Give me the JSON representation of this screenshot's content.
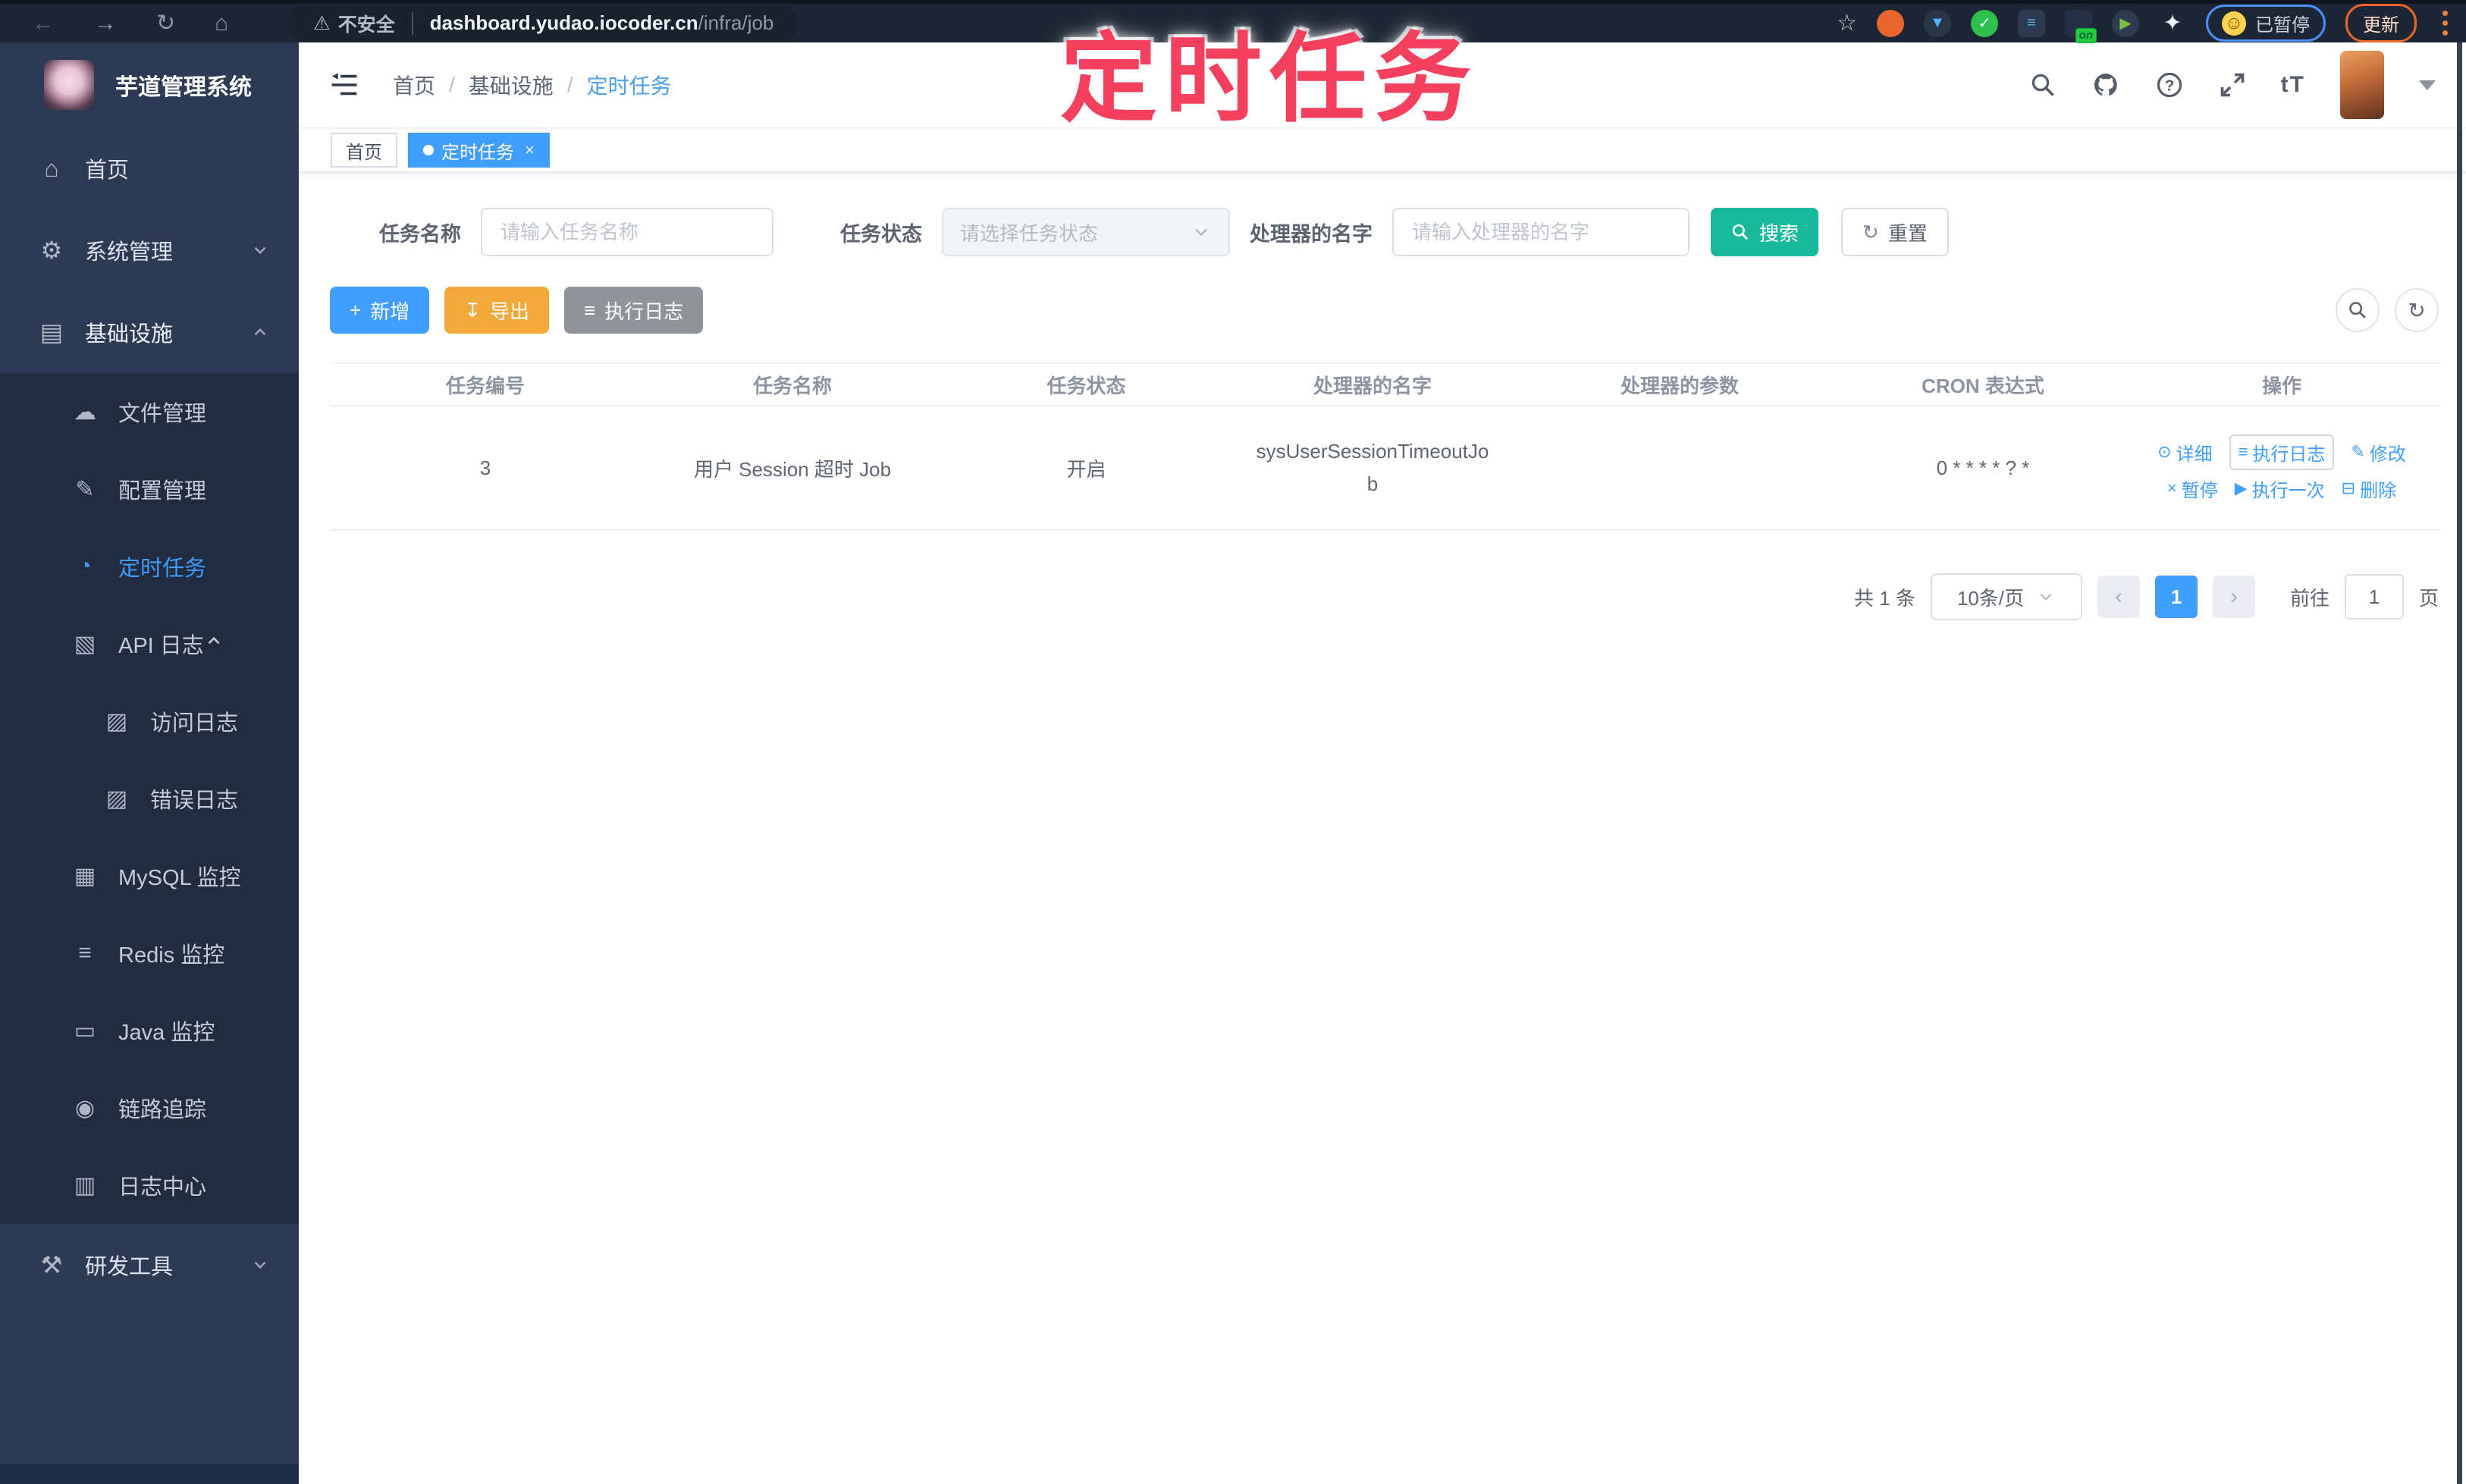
{
  "browser": {
    "url": {
      "warning_label": "不安全",
      "host": "dashboard.yudao.iocoder.cn",
      "path": "/infra/job"
    },
    "extension_badge": "on",
    "paused_pill": "已暂停",
    "update_button": "更新"
  },
  "watermark": "定时任务",
  "icons": {
    "back": "←",
    "forward": "→",
    "reload": "↻",
    "home": "⌂",
    "warning": "⚠",
    "star": "☆",
    "smile": "☺",
    "help": "?",
    "font_size": "tT",
    "refresh": "↻",
    "plus": "+",
    "download": "↧",
    "list": "≡",
    "eye": "⊙",
    "edit": "✎",
    "pause": "×",
    "run": "▶",
    "delete": "⊟",
    "prev": "‹",
    "next": "›",
    "puzzle": "✦",
    "check": "✓",
    "drop": "▼"
  },
  "sidebar": {
    "title": "芋道管理系统",
    "items": [
      {
        "label": "首页",
        "icon": "⌂"
      },
      {
        "label": "系统管理",
        "icon": "⚙"
      },
      {
        "label": "基础设施",
        "icon": "▤"
      },
      {
        "label": "研发工具",
        "icon": "⚒"
      }
    ],
    "submenu": [
      {
        "label": "文件管理",
        "icon": "☁"
      },
      {
        "label": "配置管理",
        "icon": "✎"
      },
      {
        "label": "定时任务",
        "icon": "◔"
      },
      {
        "label": "API 日志",
        "icon": "▧"
      },
      {
        "label": "访问日志",
        "icon": "▨"
      },
      {
        "label": "错误日志",
        "icon": "▨"
      },
      {
        "label": "MySQL 监控",
        "icon": "▦"
      },
      {
        "label": "Redis 监控",
        "icon": "≡"
      },
      {
        "label": "Java 监控",
        "icon": "▭"
      },
      {
        "label": "链路追踪",
        "icon": "◉"
      },
      {
        "label": "日志中心",
        "icon": "▥"
      }
    ]
  },
  "navbar": {
    "breadcrumb": [
      "首页",
      "基础设施",
      "定时任务"
    ],
    "separator": "/"
  },
  "tags": [
    {
      "label": "首页"
    },
    {
      "label": "定时任务",
      "close": "×"
    }
  ],
  "filter": {
    "name_label": "任务名称",
    "name_placeholder": "请输入任务名称",
    "status_label": "任务状态",
    "status_placeholder": "请选择任务状态",
    "handler_label": "处理器的名字",
    "handler_placeholder": "请输入处理器的名字",
    "search": "搜索",
    "reset": "重置"
  },
  "toolbar": {
    "add": "新增",
    "export": "导出",
    "job_log": "执行日志"
  },
  "table": {
    "headers": [
      "任务编号",
      "任务名称",
      "任务状态",
      "处理器的名字",
      "处理器的参数",
      "CRON 表达式",
      "操作"
    ],
    "row": {
      "id": "3",
      "name": "用户 Session 超时 Job",
      "status": "开启",
      "handler": "sysUserSessionTimeoutJob",
      "params": "",
      "cron": "0 * * * * ? *"
    },
    "ops": [
      {
        "icon": "⊙",
        "label": "详细"
      },
      {
        "icon": "≡",
        "label": "执行日志"
      },
      {
        "icon": "✎",
        "label": "修改"
      },
      {
        "icon": "×",
        "label": "暂停"
      },
      {
        "icon": "▶",
        "label": "执行一次"
      },
      {
        "icon": "⊟",
        "label": "删除"
      }
    ]
  },
  "pagination": {
    "total": "共 1 条",
    "size": "10条/页",
    "page": "1",
    "goto_label": "前往",
    "goto_value": "1",
    "unit": "页"
  },
  "colors": {
    "primary": "#409EFF",
    "success": "#18BA9B",
    "warning": "#F2A93B",
    "info": "#909399",
    "watermark": "#F43F5F"
  }
}
